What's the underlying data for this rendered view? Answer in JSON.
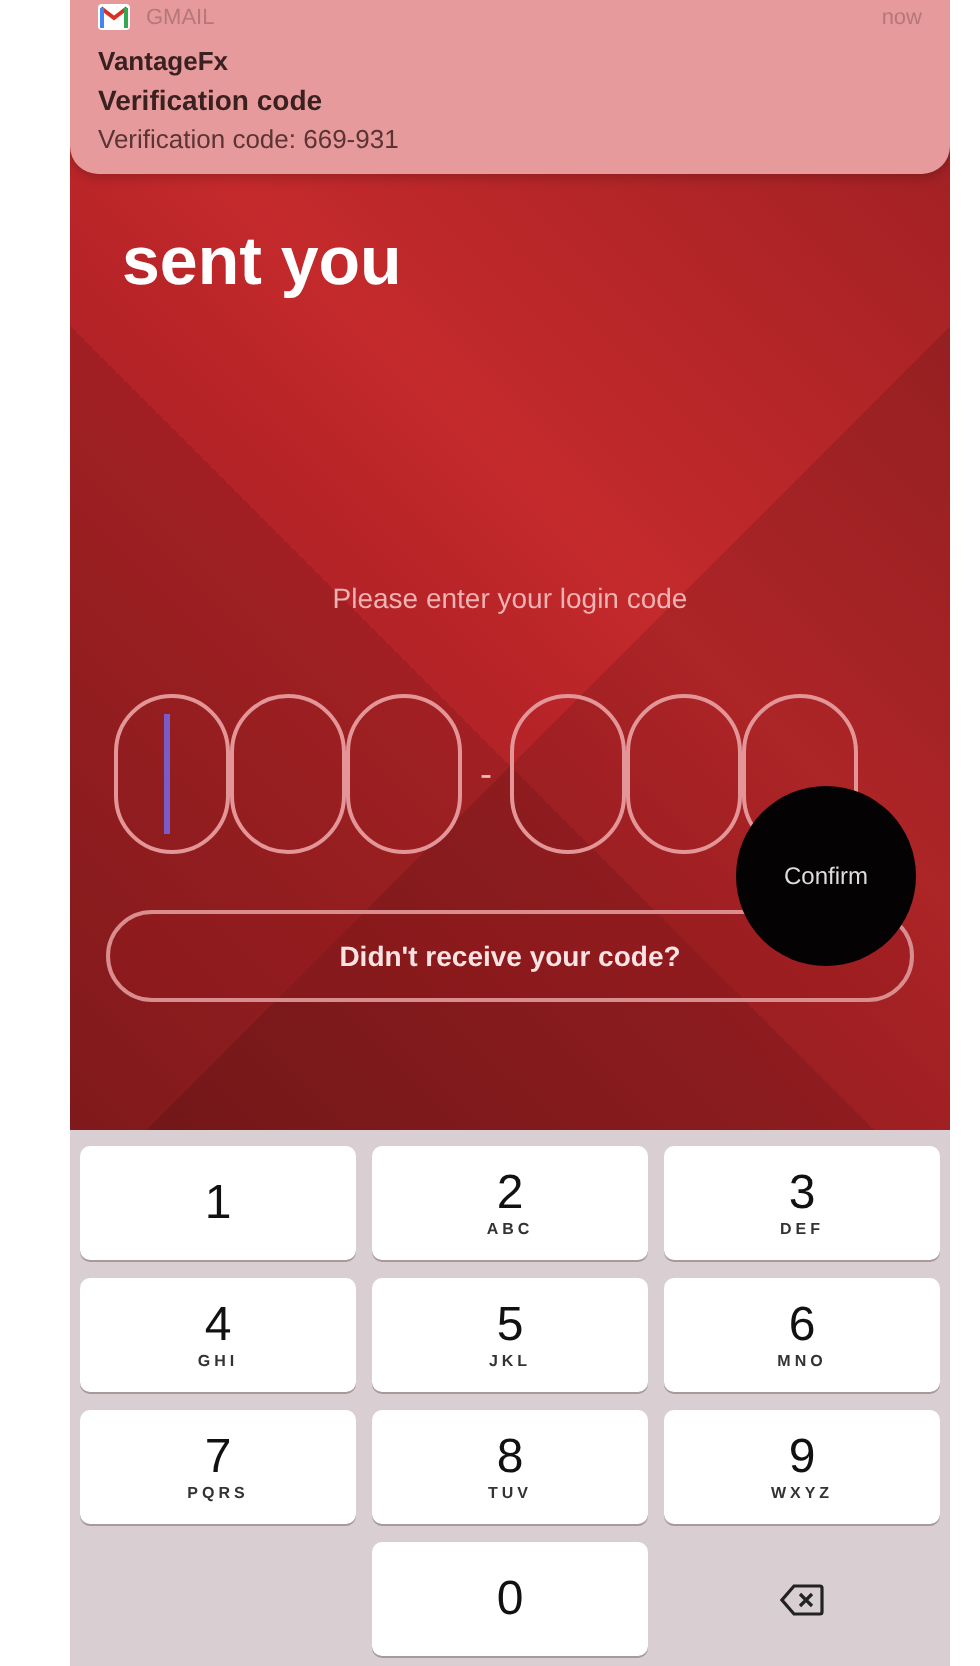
{
  "notification": {
    "app": "GMAIL",
    "time": "now",
    "sender": "VantageFx",
    "subject": "Verification code",
    "body": "Verification code: 669-931"
  },
  "heading": "sent you",
  "prompt": "Please enter your login code",
  "code_cells": [
    {
      "kind": "box",
      "focused": true
    },
    {
      "kind": "box",
      "focused": false
    },
    {
      "kind": "box",
      "focused": false
    },
    {
      "kind": "separator",
      "text": "-"
    },
    {
      "kind": "box",
      "focused": false
    },
    {
      "kind": "box",
      "focused": false
    },
    {
      "kind": "box",
      "focused": false
    }
  ],
  "confirm_button": "Confirm",
  "resend_button": "Didn't receive your code?",
  "keypad": [
    {
      "kind": "key",
      "digit": "1"
    },
    {
      "kind": "key",
      "digit": "2",
      "letters": "ABC"
    },
    {
      "kind": "key",
      "digit": "3",
      "letters": "DEF"
    },
    {
      "kind": "key",
      "digit": "4",
      "letters": "GHI"
    },
    {
      "kind": "key",
      "digit": "5",
      "letters": "JKL"
    },
    {
      "kind": "key",
      "digit": "6",
      "letters": "MNO"
    },
    {
      "kind": "key",
      "digit": "7",
      "letters": "PQRS"
    },
    {
      "kind": "key",
      "digit": "8",
      "letters": "TUV"
    },
    {
      "kind": "key",
      "digit": "9",
      "letters": "WXYZ"
    },
    {
      "kind": "blank"
    },
    {
      "kind": "key",
      "digit": "0"
    },
    {
      "kind": "backspace"
    }
  ]
}
